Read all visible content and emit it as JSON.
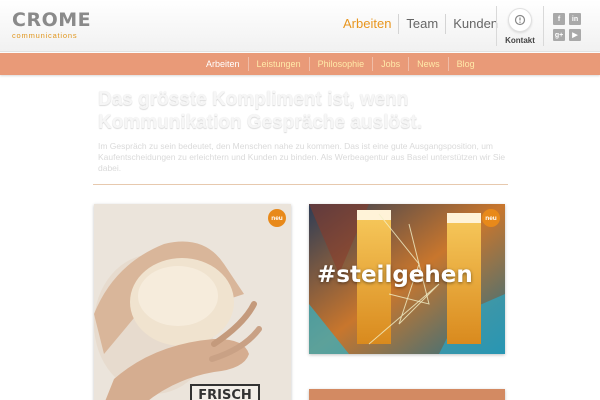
{
  "brand": {
    "name": "CROME",
    "tagline": "communications",
    "accent": "#e8961f"
  },
  "main_nav": [
    {
      "label": "Arbeiten",
      "active": true
    },
    {
      "label": "Team",
      "active": false
    },
    {
      "label": "Kunden",
      "active": false
    }
  ],
  "kontakt": {
    "label": "Kontakt",
    "icon": "contact-icon"
  },
  "social": [
    {
      "icon": "facebook-icon",
      "glyph": "f"
    },
    {
      "icon": "linkedin-icon",
      "glyph": "in"
    },
    {
      "icon": "googleplus-icon",
      "glyph": "g+"
    },
    {
      "icon": "youtube-icon",
      "glyph": "▶"
    }
  ],
  "sub_nav": {
    "color": "#e99a78",
    "items": [
      {
        "label": "Arbeiten",
        "active": true
      },
      {
        "label": "Leistungen",
        "active": false
      },
      {
        "label": "Philosophie",
        "active": false
      },
      {
        "label": "Jobs",
        "active": false
      },
      {
        "label": "News",
        "active": false
      },
      {
        "label": "Blog",
        "active": false
      }
    ]
  },
  "intro": {
    "headline": "Das grösste Kompliment ist, wenn Kommunikation Gespräche auslöst.",
    "text": "Im Gespräch zu sein bedeutet, den Menschen nahe zu kommen. Das ist eine gute Ausgangsposition, um Kaufentscheidungen zu erleichtern und Kunden zu binden. Als Werbeagentur aus Basel unterstützen wir Sie dabei."
  },
  "tiles": {
    "left": {
      "badge": "neu",
      "sign": "FRISCH"
    },
    "right": {
      "badge": "neu",
      "hashtag": "#steilgehen"
    }
  }
}
